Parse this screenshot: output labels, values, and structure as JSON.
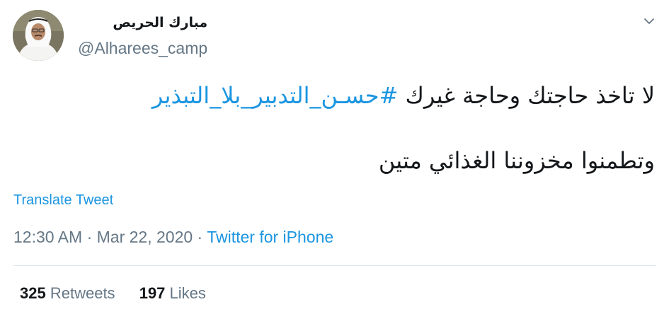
{
  "author": {
    "display_name": "مبارك الحريص",
    "handle": "@Alharees_camp"
  },
  "icons": {
    "more": "chevron-down-icon",
    "avatar": "profile-photo"
  },
  "tweet": {
    "line1_text": "لا تاخذ حاجتك وحاجة غيرك ",
    "hashtag": "#حسـن_التدبير_بلا_التبذير",
    "line2_text": "وتطمنوا مخزوننا الغذائي متين",
    "translate_label": "Translate Tweet"
  },
  "meta": {
    "time": "12:30 AM",
    "date": "Mar 22, 2020",
    "source": "Twitter for iPhone",
    "separator": " · "
  },
  "stats": {
    "retweets_count": "325",
    "retweets_label": "Retweets",
    "likes_count": "197",
    "likes_label": "Likes"
  },
  "colors": {
    "link": "#1b95e0",
    "secondary_text": "#657786",
    "primary_text": "#14171a",
    "divider": "#e1e8ed"
  }
}
